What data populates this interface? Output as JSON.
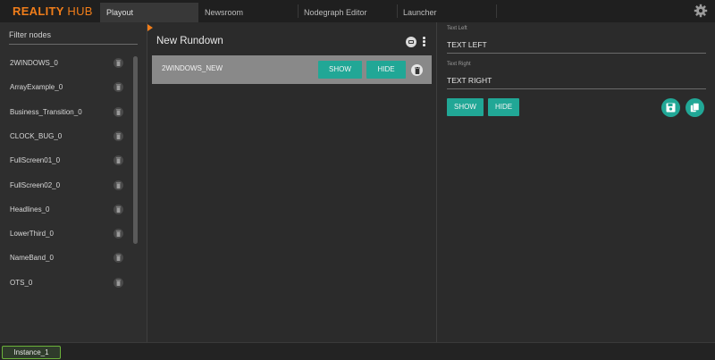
{
  "app": {
    "brand_part1": "REALITY",
    "brand_part2": "HUB"
  },
  "tabs": [
    {
      "label": "Playout",
      "active": true
    },
    {
      "label": "Newsroom",
      "active": false
    },
    {
      "label": "Nodegraph Editor",
      "active": false
    },
    {
      "label": "Launcher",
      "active": false
    }
  ],
  "sidebar": {
    "filter_placeholder": "Filter nodes",
    "nodes": [
      "2WINDOWS_0",
      "ArrayExample_0",
      "Business_Transition_0",
      "CLOCK_BUG_0",
      "FullScreen01_0",
      "FullScreen02_0",
      "Headlines_0",
      "LowerThird_0",
      "NameBand_0",
      "OTS_0"
    ]
  },
  "rundown": {
    "title": "New Rundown",
    "item": {
      "label": "2WINDOWS_NEW",
      "show_label": "SHOW",
      "hide_label": "HIDE"
    }
  },
  "properties": {
    "fields": [
      {
        "label": "Text Left",
        "value": "TEXT LEFT"
      },
      {
        "label": "Text Right",
        "value": "TEXT RIGHT"
      }
    ],
    "show_label": "SHOW",
    "hide_label": "HIDE"
  },
  "footer": {
    "instance": "Instance_1"
  },
  "colors": {
    "accent": "#21a796",
    "brand": "#f07d1a",
    "instance_border": "#6bb33a"
  },
  "icons": [
    "settings-gear-icon",
    "trash-icon",
    "tv-icon",
    "more-vertical-icon",
    "save-icon",
    "copy-icon"
  ]
}
